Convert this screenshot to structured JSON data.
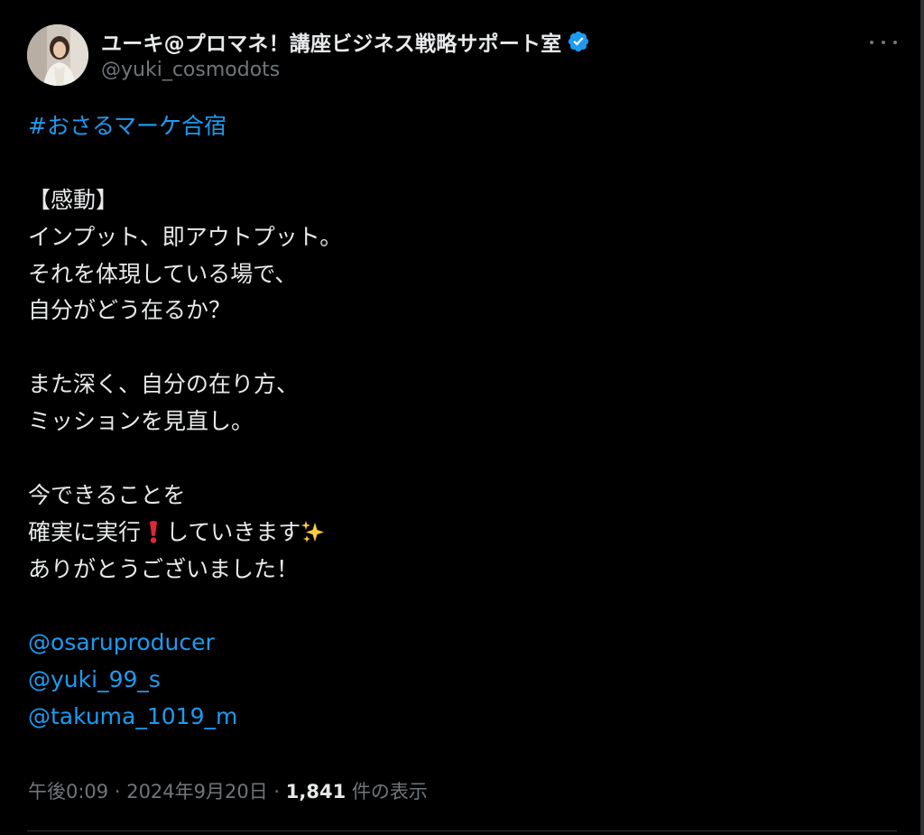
{
  "author": {
    "display_name": "ユーキ@プロマネ！講座ビジネス戦略サポート室",
    "handle": "@yuki_cosmodots",
    "verified_color": "#1d9bf0",
    "avatar_icon": "profile-photo"
  },
  "tweet": {
    "hashtag": "#おさるマーケ合宿",
    "line_1": "【感動】",
    "line_2": "インプット、即アウトプット。",
    "line_3": "それを体現している場で、",
    "line_4": "自分がどう在るか？",
    "line_5": "また深く、自分の在り方、",
    "line_6": "ミッションを見直し。",
    "line_7": "今できることを",
    "line_8a": "確実に実行",
    "line_8b": "していきます",
    "line_9": "ありがとうございました！",
    "mentions": [
      "@osaruproducer",
      "@yuki_99_s",
      "@takuma_1019_m"
    ],
    "emoji_exclamation": "red-exclamation-mark",
    "emoji_sparkles": "sparkles"
  },
  "meta": {
    "time": "午後0:09",
    "separator": " · ",
    "date": "2024年9月20日",
    "views_count": "1,841",
    "views_label": " 件の表示"
  },
  "colors": {
    "background": "#000000",
    "text": "#e7e9ea",
    "secondary": "#71767b",
    "link": "#1d9bf0"
  }
}
